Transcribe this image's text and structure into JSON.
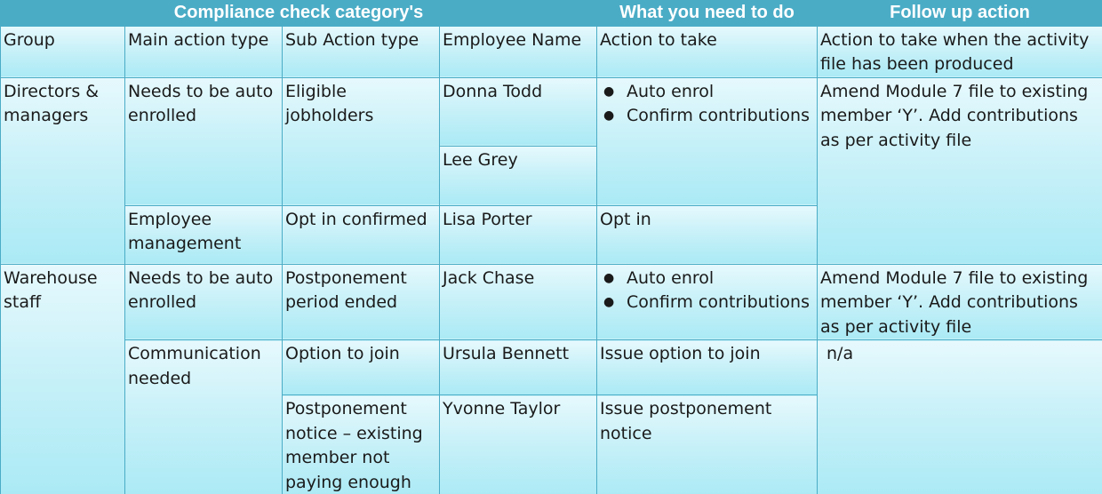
{
  "header": {
    "categories": "Compliance check category's",
    "todo": "What you need to do",
    "followup": "Follow up action"
  },
  "columns": [
    "Group",
    "Main action type",
    "Sub Action type",
    "Employee Name",
    "Action to take",
    "Action to take when the activity file has been produced"
  ],
  "rows": {
    "directors_group": "Directors & managers",
    "directors_main1": "Needs to be auto enrolled",
    "directors_sub1": "Eligible jobholders",
    "directors_emp1": "Donna Todd",
    "directors_emp2": "Lee Grey",
    "directors_action1": [
      "Auto enrol",
      "Confirm contributions"
    ],
    "directors_follow": "Amend Module 7 file to existing member ‘Y’. Add contributions as per activity file",
    "directors_main2": "Employee management",
    "directors_sub2": "Opt in confirmed",
    "directors_emp3": "Lisa Porter",
    "directors_action2": "Opt in",
    "warehouse_group": "Warehouse staff",
    "warehouse_main1": "Needs to be auto enrolled",
    "warehouse_sub1": "Postponement period ended",
    "warehouse_emp1": "Jack Chase",
    "warehouse_action1": [
      "Auto enrol",
      "Confirm contributions"
    ],
    "warehouse_follow1": "Amend Module 7 file to existing member ‘Y’. Add contributions as per activity file",
    "warehouse_main2": "Communication needed",
    "warehouse_sub2": "Option to join",
    "warehouse_emp2": "Ursula Bennett",
    "warehouse_action2": "Issue option to join",
    "warehouse_follow2": "n/a",
    "warehouse_sub3": "Postponement notice – existing member not paying enough",
    "warehouse_emp3": "Yvonne Taylor",
    "warehouse_action3": "Issue postponement notice"
  },
  "icons": {
    "bullet": "●"
  },
  "colors": {
    "header_bg": "#4bacc6",
    "header_text": "#ffffff",
    "border": "#4bacc6"
  }
}
